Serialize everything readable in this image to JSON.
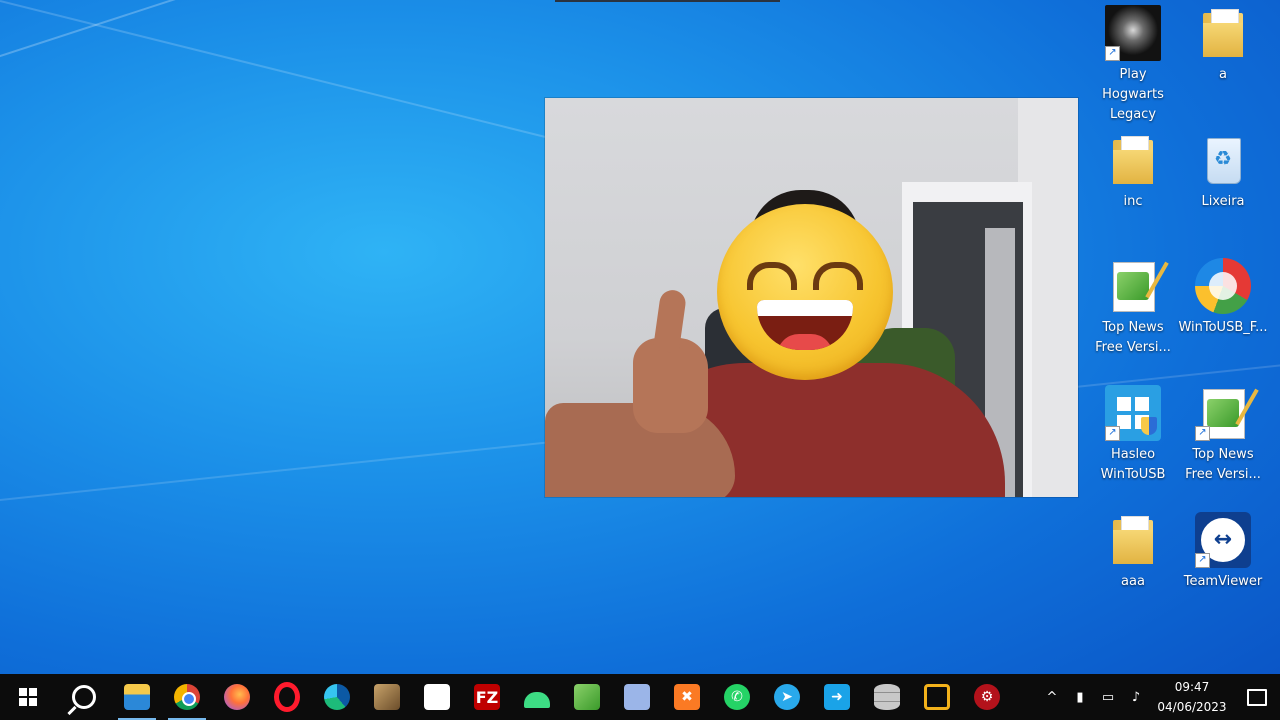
{
  "desktop": {
    "icons": [
      {
        "label": "Play Hogwarts Legacy",
        "icon": "hogwarts-legacy-icon",
        "shortcut": true
      },
      {
        "label": "a",
        "icon": "folder-icon",
        "shortcut": false
      },
      {
        "label": "inc",
        "icon": "folder-icon",
        "shortcut": false
      },
      {
        "label": "Lixeira",
        "icon": "recycle-bin-icon",
        "shortcut": false
      },
      {
        "label": "Top News Free Versi...",
        "icon": "notepadpp-document-icon",
        "shortcut": false
      },
      {
        "label": "WinToUSB_F...",
        "icon": "wintousb-icon",
        "shortcut": false
      },
      {
        "label": "Hasleo WinToUSB",
        "icon": "hasleo-wintousb-icon",
        "shortcut": true
      },
      {
        "label": "Top News Free Versi...",
        "icon": "notepadpp-document-icon",
        "shortcut": true
      },
      {
        "label": "aaa",
        "icon": "folder-icon",
        "shortcut": false
      },
      {
        "label": "TeamViewer",
        "icon": "teamviewer-icon",
        "shortcut": true
      }
    ]
  },
  "taskbar": {
    "apps": [
      {
        "name": "start",
        "icon": "windows-start-icon",
        "glyph": ""
      },
      {
        "name": "search",
        "icon": "search-icon",
        "glyph": ""
      },
      {
        "name": "file-explorer",
        "icon": "file-explorer-icon",
        "glyph": ""
      },
      {
        "name": "chrome",
        "icon": "chrome-icon",
        "glyph": ""
      },
      {
        "name": "firefox",
        "icon": "firefox-icon",
        "glyph": ""
      },
      {
        "name": "opera",
        "icon": "opera-icon",
        "glyph": ""
      },
      {
        "name": "edge",
        "icon": "edge-icon",
        "glyph": ""
      },
      {
        "name": "app-tools",
        "icon": "tools-app-icon",
        "glyph": ""
      },
      {
        "name": "app-office",
        "icon": "office-app-icon",
        "glyph": ""
      },
      {
        "name": "filezilla",
        "icon": "filezilla-icon",
        "glyph": "FZ"
      },
      {
        "name": "android-studio",
        "icon": "android-icon",
        "glyph": ""
      },
      {
        "name": "notepadpp",
        "icon": "notepadpp-icon",
        "glyph": ""
      },
      {
        "name": "obs",
        "icon": "obs-icon",
        "glyph": ""
      },
      {
        "name": "xampp",
        "icon": "xampp-icon",
        "glyph": "✖"
      },
      {
        "name": "whatsapp",
        "icon": "whatsapp-icon",
        "glyph": "✆"
      },
      {
        "name": "telegram",
        "icon": "telegram-icon",
        "glyph": "➤"
      },
      {
        "name": "remote-desktop",
        "icon": "remote-desktop-icon",
        "glyph": "➜"
      },
      {
        "name": "database",
        "icon": "database-icon",
        "glyph": ""
      },
      {
        "name": "vmware",
        "icon": "vmware-icon",
        "glyph": ""
      },
      {
        "name": "red-gear",
        "icon": "red-gear-icon",
        "glyph": "⚙"
      }
    ],
    "active": [
      "file-explorer",
      "chrome"
    ],
    "tray": {
      "chevron": "^",
      "time": "09:47",
      "date": "04/06/2023"
    }
  }
}
